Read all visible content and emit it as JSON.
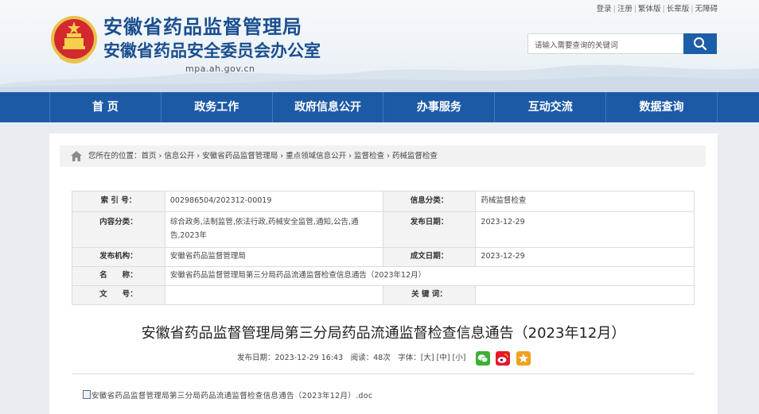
{
  "header": {
    "title": "安徽省药品监督管理局",
    "subtitle": "安徽省药品安全委员会办公室",
    "domain": "mpa.ah.gov.cn"
  },
  "toplinks": [
    "登录",
    "注册",
    "繁体版",
    "长辈版",
    "无障碍"
  ],
  "search": {
    "placeholder": "请输入需要查询的关键词"
  },
  "nav": [
    "首 页",
    "政务工作",
    "政府信息公开",
    "办事服务",
    "互动交流",
    "数据查询"
  ],
  "breadcrumb": {
    "prefix": "您所在的位置：",
    "items": [
      "首页",
      "信息公开",
      "安徽省药品监督管理局",
      "重点领域信息公开",
      "监督检查",
      "药械监督检查"
    ]
  },
  "meta_table": {
    "index_label": "索 引 号：",
    "index_value": "002986504/202312-00019",
    "category_label": "信息分类：",
    "category_value": "药械监督检查",
    "content_label": "内容分类：",
    "content_value": "综合政务,法制监管,依法行政,药械安全监管,通知,公告,通告,2023年",
    "publish_label": "发布日期：",
    "publish_value": "2023-12-29",
    "org_label": "发布机构：",
    "org_value": "安徽省药品监督管理局",
    "created_label": "成文日期：",
    "created_value": "2023-12-29",
    "name_label": "名　　称：",
    "name_value": "安徽省药品监督管理局第三分局药品流通监督检查信息通告（2023年12月）",
    "docno_label": "文　　号：",
    "docno_value": "",
    "keyword_label": "关 键 词：",
    "keyword_value": ""
  },
  "article": {
    "title": "安徽省药品监督管理局第三分局药品流通监督检查信息通告（2023年12月）",
    "publish_info": "发布日期：2023-12-29 16:43　阅读：48次　字体：[大] [中] [小]",
    "attachment": "安徽省药品监督管理局第三分局药品流通监督检查信息通告（2023年12月）.doc"
  },
  "colors": {
    "brand": "#1c5aa6",
    "title": "#1a4f8f",
    "wechat": "#3cb034",
    "weibo": "#e6162d",
    "favorite": "#f0a020"
  }
}
